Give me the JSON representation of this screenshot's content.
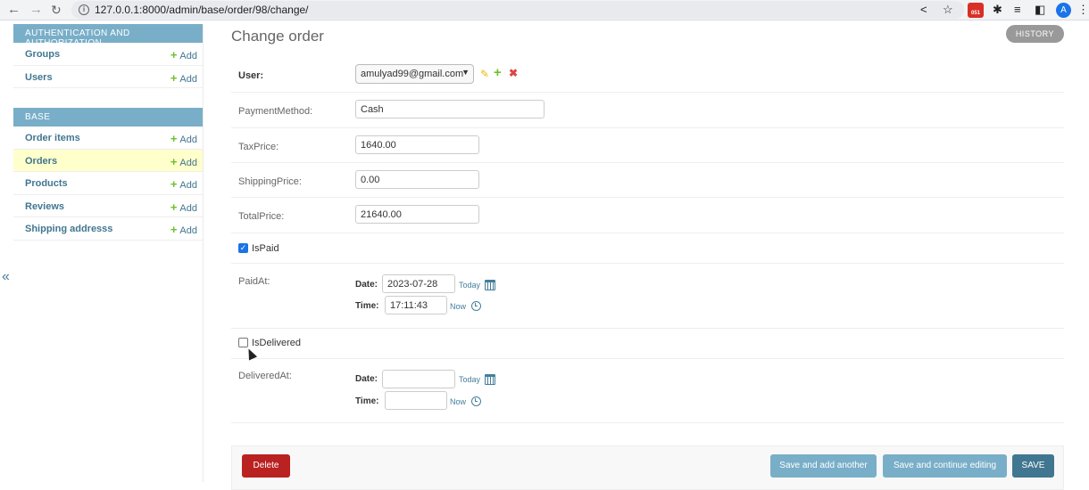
{
  "browser": {
    "url": "127.0.0.1:8000/admin/base/order/98/change/",
    "extension_badge": "051",
    "profile_initial": "A"
  },
  "sidebar": {
    "modules": [
      {
        "caption": "AUTHENTICATION AND AUTHORIZATION",
        "items": [
          {
            "label": "Groups",
            "add": "Add"
          },
          {
            "label": "Users",
            "add": "Add"
          }
        ]
      },
      {
        "caption": "BASE",
        "items": [
          {
            "label": "Order items",
            "add": "Add"
          },
          {
            "label": "Orders",
            "add": "Add",
            "current": true
          },
          {
            "label": "Products",
            "add": "Add"
          },
          {
            "label": "Reviews",
            "add": "Add"
          },
          {
            "label": "Shipping addresss",
            "add": "Add"
          }
        ]
      }
    ],
    "collapse": "«"
  },
  "main": {
    "title": "Change order",
    "history": "HISTORY",
    "fields": {
      "user": {
        "label": "User:",
        "value": "amulyad99@gmail.com"
      },
      "payment": {
        "label": "PaymentMethod:",
        "value": "Cash"
      },
      "tax": {
        "label": "TaxPrice:",
        "value": "1640.00"
      },
      "shipping": {
        "label": "ShippingPrice:",
        "value": "0.00"
      },
      "total": {
        "label": "TotalPrice:",
        "value": "21640.00"
      },
      "is_paid": {
        "label": "IsPaid",
        "checked": true
      },
      "paid_at": {
        "label": "PaidAt:",
        "date_label": "Date:",
        "date": "2023-07-28",
        "today": "Today",
        "time_label": "Time:",
        "time": "17:11:43",
        "now": "Now"
      },
      "is_delivered": {
        "label": "IsDelivered",
        "checked": false
      },
      "delivered_at": {
        "label": "DeliveredAt:",
        "date_label": "Date:",
        "date": "",
        "today": "Today",
        "time_label": "Time:",
        "time": "",
        "now": "Now"
      }
    },
    "actions": {
      "delete": "Delete",
      "save_add": "Save and add another",
      "save_continue": "Save and continue editing",
      "save": "SAVE"
    }
  },
  "colors": {
    "header_blue": "#79aec8",
    "delete_red": "#ba2121",
    "save_dark": "#417690",
    "save_light": "#79aec8",
    "current_row": "#ffffcc"
  }
}
